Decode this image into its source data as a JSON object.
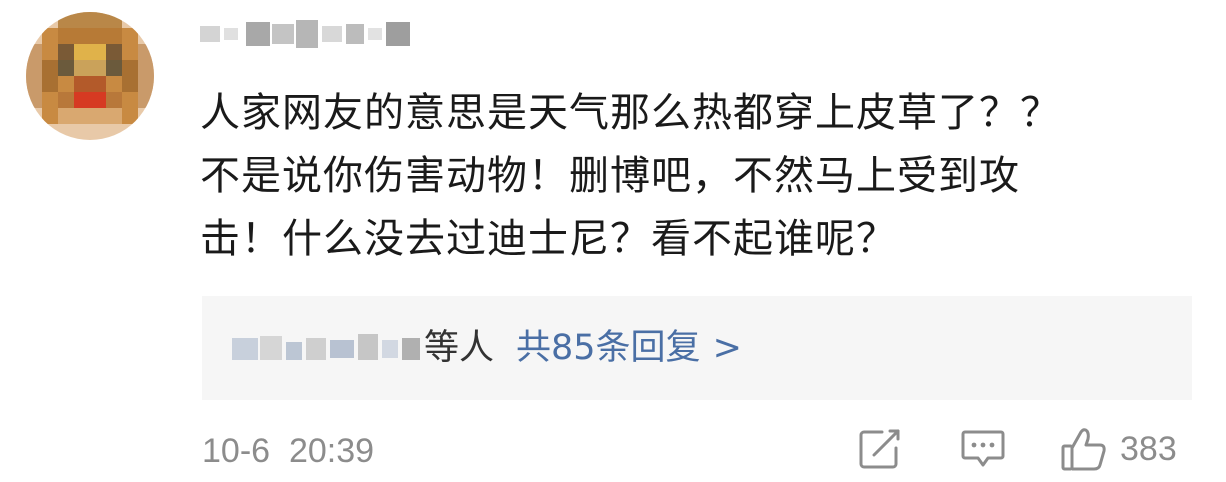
{
  "comment": {
    "author": {
      "avatar_icon": "pixelated-avatar",
      "username_icon": "blurred-username"
    },
    "text_lines": [
      "人家网友的意思是天气那么热都穿上皮草了？？",
      "不是说你伤害动物！删博吧，不然马上受到攻",
      "击！什么没去过迪士尼？看不起谁呢？"
    ],
    "replies": {
      "names_icon": "blurred-reply-names",
      "suffix": "等人",
      "count_label": "共85条回复",
      "chevron": ">"
    },
    "timestamp": "10-6  20:39",
    "actions": {
      "share_icon": "share-icon",
      "comment_icon": "comment-icon",
      "like_icon": "thumbs-up-icon",
      "like_count": "383"
    }
  },
  "colors": {
    "text": "#1a1a1a",
    "link": "#4a6fa5",
    "muted": "#8c8c8c",
    "reply_bg": "#f6f6f6"
  }
}
